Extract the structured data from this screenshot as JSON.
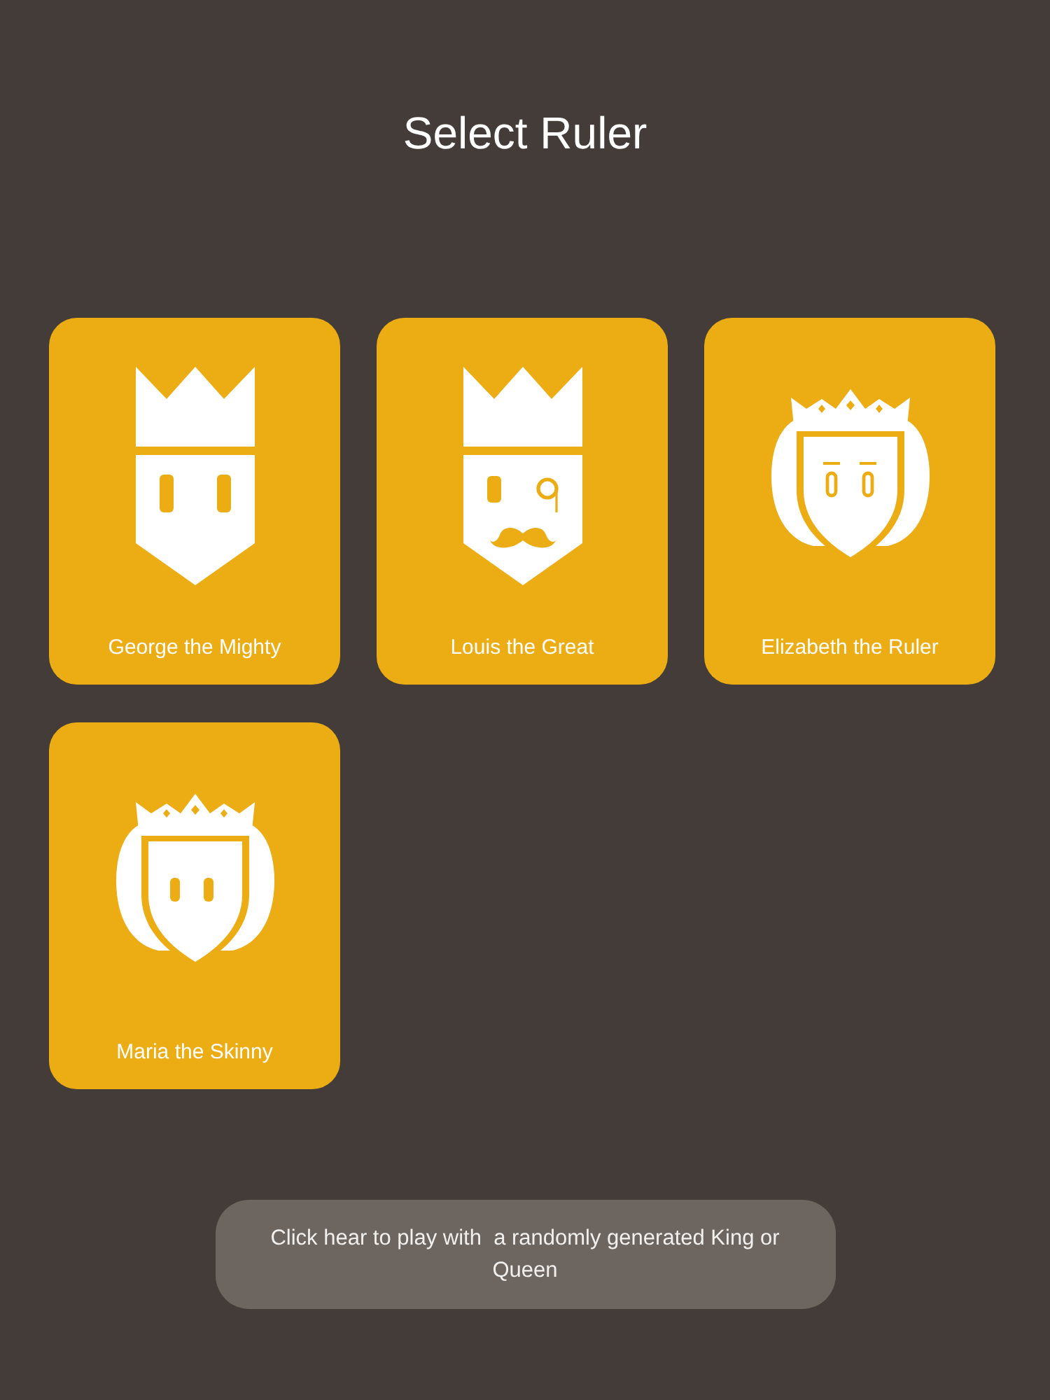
{
  "title": "Select Ruler",
  "rulers": [
    {
      "name": "George the Mighty",
      "kind": "king"
    },
    {
      "name": "Louis the Great",
      "kind": "dandy"
    },
    {
      "name": "Elizabeth the Ruler",
      "kind": "queen"
    },
    {
      "name": "Maria the Skinny",
      "kind": "maiden"
    }
  ],
  "random_button": {
    "label": "Click hear to play with  a randomly generated King or Queen"
  }
}
